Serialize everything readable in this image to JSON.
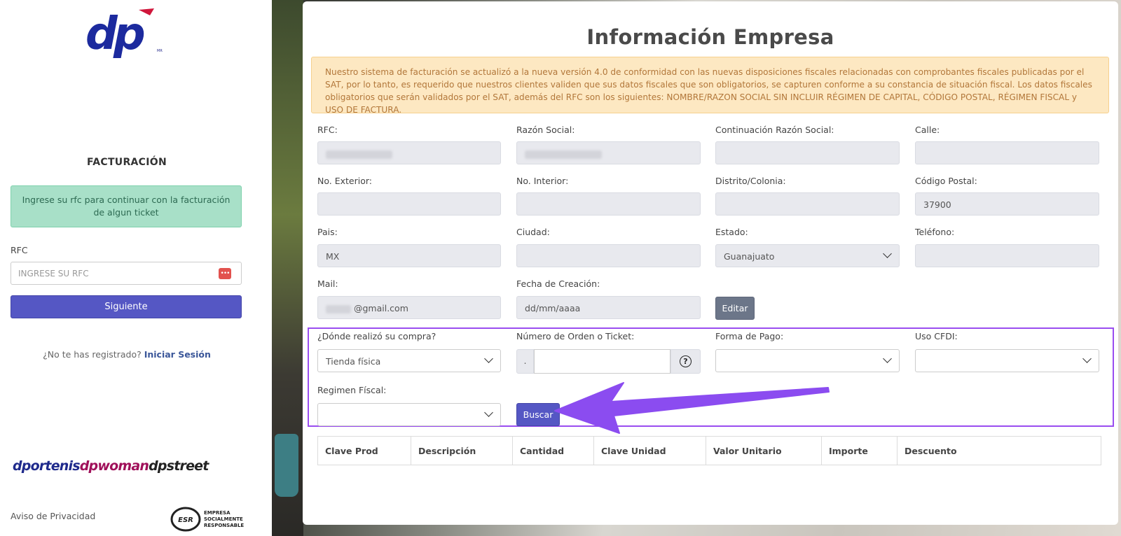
{
  "left_panel": {
    "logo_text": "dp",
    "logo_mark": "MR",
    "section_title": "FACTURACIÓN",
    "info_message": "Ingrese su rfc para continuar con la facturación de algun ticket",
    "rfc_label": "RFC",
    "rfc_placeholder": "INGRESE SU RFC",
    "next_button": "Siguiente",
    "register_text": "¿No te has registrado?",
    "login_link": "Iniciar Sesión",
    "brands": [
      "dportenis",
      "dpwoman",
      "dpstreet"
    ],
    "privacy_link": "Aviso de Privacidad",
    "esr_badge": "ESR",
    "esr_text": [
      "EMPRESA",
      "SOCIALMENTE",
      "RESPONSABLE"
    ]
  },
  "main": {
    "title": "Información Empresa",
    "warning": "Nuestro sistema de facturación se actualizó a la nueva versión 4.0 de conformidad con las nuevas disposiciones fiscales relacionadas con comprobantes fiscales publicadas por el SAT, por lo tanto, es requerido que nuestros clientes validen que sus datos fiscales que son obligatorios, se capturen conforme a su constancia de situación fiscal. Los datos fiscales obligatorios que serán validados por el SAT, además del RFC son los siguientes: NOMBRE/RAZON SOCIAL SIN INCLUIR RÉGIMEN DE CAPITAL, CÓDIGO POSTAL, RÉGIMEN FISCAL y USO DE FACTURA.",
    "labels": {
      "rfc": "RFC:",
      "razon_social": "Razón Social:",
      "continuacion": "Continuación Razón Social:",
      "calle": "Calle:",
      "no_exterior": "No. Exterior:",
      "no_interior": "No. Interior:",
      "distrito": "Distrito/Colonia:",
      "codigo_postal": "Código Postal:",
      "pais": "Pais:",
      "ciudad": "Ciudad:",
      "estado": "Estado:",
      "telefono": "Teléfono:",
      "mail": "Mail:",
      "fecha": "Fecha de Creación:",
      "donde": "¿Dónde realizó su compra?",
      "numero_orden": "Número de Orden o Ticket:",
      "forma_pago": "Forma de Pago:",
      "uso_cfdi": "Uso CFDI:",
      "regimen": "Regimen Físcal:"
    },
    "values": {
      "codigo_postal": "37900",
      "pais": "MX",
      "estado": "Guanajuato",
      "mail_suffix": "@gmail.com",
      "fecha_placeholder": "dd/mm/aaaa",
      "donde": "Tienda física",
      "ticket_prefix": ".",
      "help_symbol": "?"
    },
    "edit_button": "Editar",
    "search_button": "Buscar",
    "table_headers": [
      "Clave Prod",
      "Descripción",
      "Cantidad",
      "Clave Unidad",
      "Valor Unitario",
      "Importe",
      "Descuento"
    ],
    "colors": {
      "primary_button": "#5557c4",
      "highlight_border": "#9a4df0",
      "warning_bg": "#fde8c2",
      "success_bg": "#a8e0c8"
    }
  }
}
